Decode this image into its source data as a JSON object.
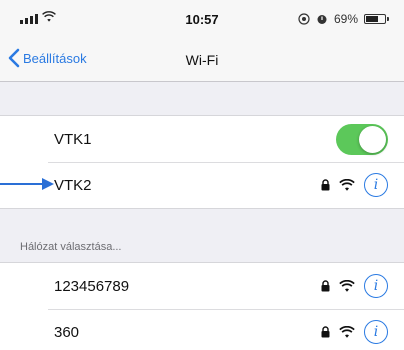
{
  "status_bar": {
    "time": "10:57",
    "battery": "69%",
    "battery_level": 0.69
  },
  "nav": {
    "back_label": "Beállítások",
    "title": "Wi-Fi"
  },
  "wifi_toggle": {
    "label": "VTK1",
    "on": true
  },
  "connected_network": {
    "name": "VTK2",
    "locked": true
  },
  "section_header": "Hálózat választása...",
  "networks": [
    {
      "name": "123456789",
      "locked": true
    },
    {
      "name": "360",
      "locked": true
    }
  ],
  "colors": {
    "accent": "#2a7ae2",
    "toggle_on": "#5cc85a",
    "arrow": "#2a6fd6"
  },
  "icons": {
    "back": "chevron-left-icon",
    "lock": "lock-icon",
    "wifi": "wifi-icon",
    "info": "info-icon"
  }
}
